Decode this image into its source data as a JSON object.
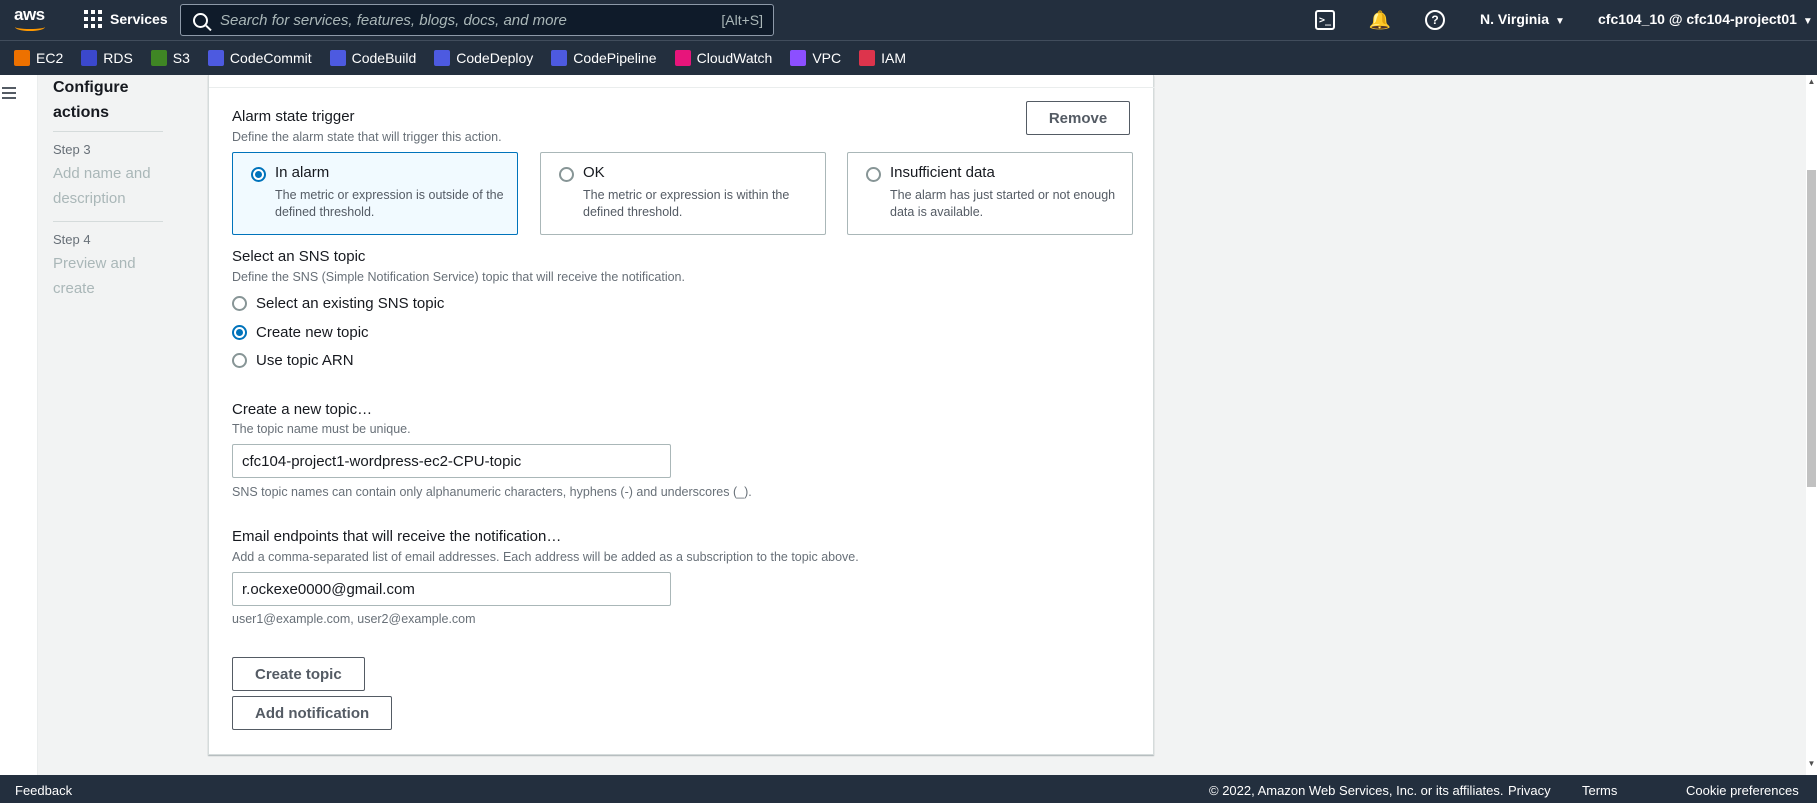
{
  "topnav": {
    "logo_text": "aws",
    "services_label": "Services",
    "search_placeholder": "Search for services, features, blogs, docs, and more",
    "search_shortcut": "[Alt+S]",
    "cloudshell_glyph": ">_",
    "bell_glyph": "🔔",
    "help_glyph": "?",
    "region": "N. Virginia",
    "account": "cfc104_10 @ cfc104-project01"
  },
  "favorites": [
    {
      "label": "EC2",
      "color": "#ed7100"
    },
    {
      "label": "RDS",
      "color": "#3b48cc"
    },
    {
      "label": "S3",
      "color": "#3f8624"
    },
    {
      "label": "CodeCommit",
      "color": "#4d5ae0"
    },
    {
      "label": "CodeBuild",
      "color": "#4d5ae0"
    },
    {
      "label": "CodeDeploy",
      "color": "#4d5ae0"
    },
    {
      "label": "CodePipeline",
      "color": "#4d5ae0"
    },
    {
      "label": "CloudWatch",
      "color": "#e7157b"
    },
    {
      "label": "VPC",
      "color": "#8c4fff"
    },
    {
      "label": "IAM",
      "color": "#dd344c"
    }
  ],
  "steps": {
    "current": "Configure actions",
    "step3_num": "Step 3",
    "step3_name": "Add name and description",
    "step4_num": "Step 4",
    "step4_name": "Preview and create"
  },
  "alarm": {
    "title": "Alarm state trigger",
    "description": "Define the alarm state that will trigger this action.",
    "remove_label": "Remove",
    "tiles": [
      {
        "title": "In alarm",
        "desc": "The metric or expression is outside of the defined threshold.",
        "selected": true
      },
      {
        "title": "OK",
        "desc": "The metric or expression is within the defined threshold.",
        "selected": false
      },
      {
        "title": "Insufficient data",
        "desc": "The alarm has just started or not enough data is available.",
        "selected": false
      }
    ]
  },
  "sns": {
    "title": "Select an SNS topic",
    "description": "Define the SNS (Simple Notification Service) topic that will receive the notification.",
    "options": [
      {
        "label": "Select an existing SNS topic",
        "selected": false
      },
      {
        "label": "Create new topic",
        "selected": true
      },
      {
        "label": "Use topic ARN",
        "selected": false
      }
    ]
  },
  "new_topic": {
    "title": "Create a new topic…",
    "description": "The topic name must be unique.",
    "value": "cfc104-project1-wordpress-ec2-CPU-topic",
    "hint": "SNS topic names can contain only alphanumeric characters, hyphens (-) and underscores (_)."
  },
  "email": {
    "title": "Email endpoints that will receive the notification…",
    "description": "Add a comma-separated list of email addresses. Each address will be added as a subscription to the topic above.",
    "value": "r.ockexe0000@gmail.com",
    "hint": "user1@example.com, user2@example.com"
  },
  "buttons": {
    "create_topic": "Create topic",
    "add_notification": "Add notification"
  },
  "footer": {
    "feedback": "Feedback",
    "copyright": "© 2022, Amazon Web Services, Inc. or its affiliates.",
    "privacy": "Privacy",
    "terms": "Terms",
    "cookies": "Cookie preferences"
  }
}
